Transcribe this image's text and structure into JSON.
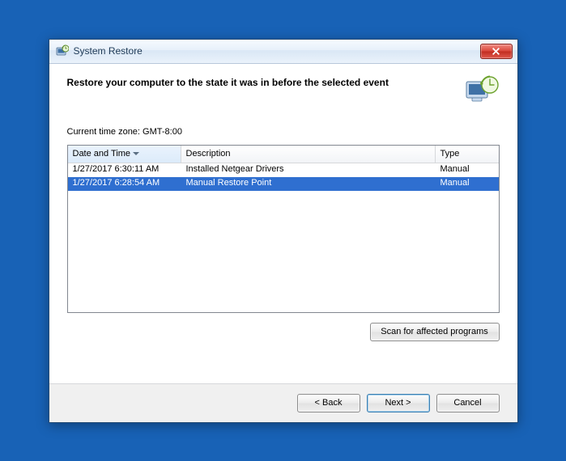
{
  "window": {
    "title": "System Restore"
  },
  "page": {
    "heading": "Restore your computer to the state it was in before the selected event",
    "timezone_label": "Current time zone: GMT-8:00"
  },
  "table": {
    "columns": {
      "date": "Date and Time",
      "description": "Description",
      "type": "Type"
    },
    "rows": [
      {
        "date": "1/27/2017 6:30:11 AM",
        "description": "Installed Netgear Drivers",
        "type": "Manual",
        "selected": false
      },
      {
        "date": "1/27/2017 6:28:54 AM",
        "description": "Manual Restore Point",
        "type": "Manual",
        "selected": true
      }
    ]
  },
  "buttons": {
    "scan_affected": "Scan for affected programs",
    "back": "< Back",
    "next": "Next >",
    "cancel": "Cancel"
  }
}
